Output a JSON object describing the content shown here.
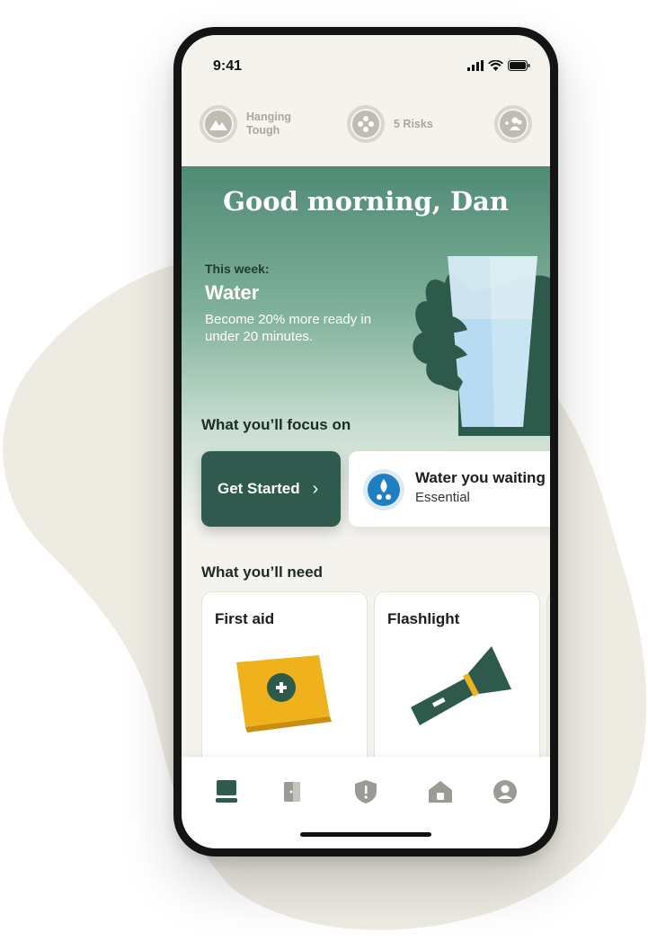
{
  "status_bar": {
    "time": "9:41",
    "icons": [
      "signal-icon",
      "wifi-icon",
      "battery-icon"
    ]
  },
  "stats": {
    "mood": {
      "label": "Hanging Tough",
      "icon": "mountain-icon"
    },
    "risks": {
      "label": "5 Risks",
      "icon": "risks-icon"
    },
    "people": {
      "icon": "add-people-icon"
    }
  },
  "hero": {
    "greeting": "Good morning, Dan",
    "week_label": "This week:",
    "week_title": "Water",
    "week_desc": "Become 20% more ready in under 20 minutes."
  },
  "focus": {
    "heading": "What you’ll focus on",
    "get_started": "Get Started",
    "card_title": "Water you waiting",
    "card_sub": "Essential",
    "card_icon": "water-drop-icon"
  },
  "needs": {
    "heading": "What you’ll need",
    "items": [
      {
        "label": "First aid",
        "icon": "first-aid-kit-icon"
      },
      {
        "label": "Flashlight",
        "icon": "flashlight-icon"
      }
    ]
  },
  "bottom_nav": {
    "items": [
      "home-icon",
      "door-icon",
      "shield-icon",
      "house-icon",
      "profile-icon"
    ],
    "active": "home-icon"
  },
  "colors": {
    "brand_green": "#2f5a4d",
    "accent_yellow": "#f0b21c",
    "water_blue": "#1f7fc1",
    "background": "#f5f3ee"
  }
}
